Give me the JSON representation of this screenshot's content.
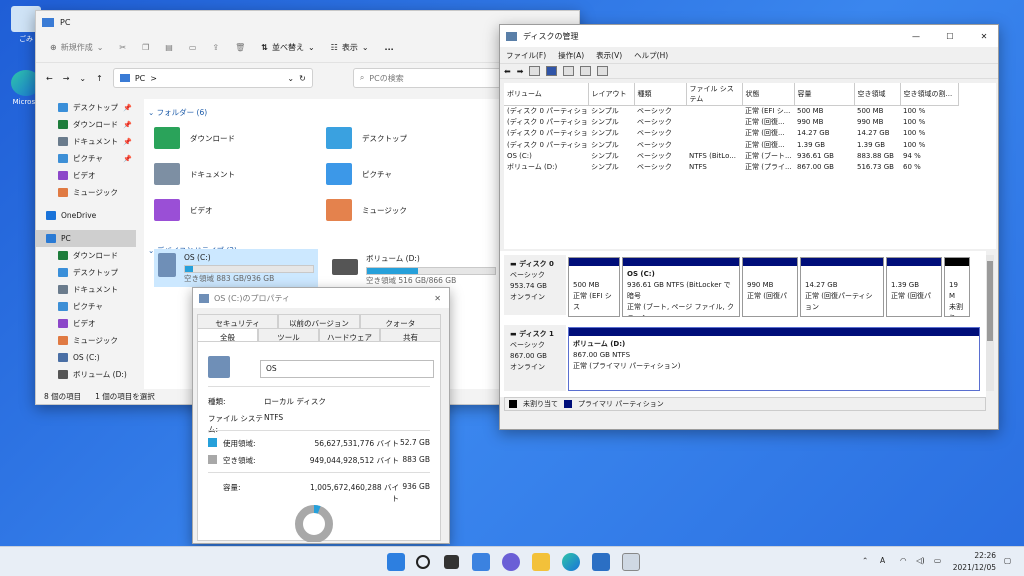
{
  "desktop": {
    "icons": [
      {
        "label": "ごみ"
      },
      {
        "label": "Microso"
      }
    ]
  },
  "explorer": {
    "title": "PC",
    "cmd": {
      "new": "新規作成",
      "sort": "並べ替え",
      "view": "表示",
      "more": "..."
    },
    "address": "PC",
    "address_sep": ">",
    "search_placeholder": "PCの検索",
    "nav": [
      {
        "label": "デスクトップ",
        "pinned": true,
        "color": "#3a8fd9"
      },
      {
        "label": "ダウンロード",
        "pinned": true,
        "color": "#1e7d3c"
      },
      {
        "label": "ドキュメント",
        "pinned": true,
        "color": "#6a7b8c"
      },
      {
        "label": "ピクチャ",
        "pinned": true,
        "color": "#3d8fd6"
      },
      {
        "label": "ビデオ",
        "pinned": false,
        "color": "#8c47c9"
      },
      {
        "label": "ミュージック",
        "pinned": false,
        "color": "#e07a43"
      },
      {
        "label": "OneDrive",
        "pinned": false,
        "color": "#1a73d9"
      },
      {
        "label": "PC",
        "pinned": false,
        "color": "#2a7ad4"
      },
      {
        "label": "ダウンロード",
        "pinned": false,
        "color": "#1e7d3c"
      },
      {
        "label": "デスクトップ",
        "pinned": false,
        "color": "#3a8fd9"
      },
      {
        "label": "ドキュメント",
        "pinned": false,
        "color": "#6a7b8c"
      },
      {
        "label": "ピクチャ",
        "pinned": false,
        "color": "#3d8fd6"
      },
      {
        "label": "ビデオ",
        "pinned": false,
        "color": "#8c47c9"
      },
      {
        "label": "ミュージック",
        "pinned": false,
        "color": "#e07a43"
      },
      {
        "label": "OS (C:)",
        "pinned": false,
        "color": "#4a6fa5"
      },
      {
        "label": "ボリューム (D:)",
        "pinned": false,
        "color": "#555"
      }
    ],
    "folders_header": "フォルダー (6)",
    "folders": [
      {
        "label": "ダウンロード",
        "color": "#2aa35a"
      },
      {
        "label": "デスクトップ",
        "color": "#3aa1e0"
      },
      {
        "label": "ドキュメント",
        "color": "#7d8fa3"
      },
      {
        "label": "ピクチャ",
        "color": "#3c98e8"
      },
      {
        "label": "ビデオ",
        "color": "#9a4fd6"
      },
      {
        "label": "ミュージック",
        "color": "#e4824d"
      }
    ],
    "drives_header": "デバイスとドライブ (2)",
    "drives": [
      {
        "label": "OS (C:)",
        "free": "空き領域 883 GB/936 GB",
        "used_fraction": 0.06
      },
      {
        "label": "ボリューム (D:)",
        "free": "空き領域 516 GB/866 GB",
        "used_fraction": 0.4
      }
    ],
    "status": {
      "count": "8 個の項目",
      "selected": "1 個の項目を選択"
    }
  },
  "props": {
    "title": "OS (C:)のプロパティ",
    "tabs_top": [
      "セキュリティ",
      "以前のバージョン",
      "クォータ"
    ],
    "tabs_bottom": [
      "全般",
      "ツール",
      "ハードウェア",
      "共有"
    ],
    "name": "OS",
    "type_label": "種類:",
    "type_value": "ローカル ディスク",
    "fs_label": "ファイル システム:",
    "fs_value": "NTFS",
    "used_label": "使用領域:",
    "used_bytes": "56,627,531,776 バイト",
    "used_gb": "52.7 GB",
    "free_label": "空き領域:",
    "free_bytes": "949,044,928,512 バイト",
    "free_gb": "883 GB",
    "cap_label": "容量:",
    "cap_bytes": "1,005,672,460,288 バイト",
    "cap_gb": "936 GB",
    "used_fraction": 0.056
  },
  "dm": {
    "title": "ディスクの管理",
    "menu": [
      "ファイル(F)",
      "操作(A)",
      "表示(V)",
      "ヘルプ(H)"
    ],
    "columns": [
      "ボリューム",
      "レイアウト",
      "種類",
      "ファイル システム",
      "状態",
      "容量",
      "空き領域",
      "空き領域の割..."
    ],
    "rows": [
      [
        "(ディスク 0 パーティショ...",
        "シンプル",
        "ベーシック",
        "",
        "正常 (EFI シ...",
        "500 MB",
        "500 MB",
        "100 %"
      ],
      [
        "(ディスク 0 パーティショ...",
        "シンプル",
        "ベーシック",
        "",
        "正常 (回復...",
        "990 MB",
        "990 MB",
        "100 %"
      ],
      [
        "(ディスク 0 パーティショ...",
        "シンプル",
        "ベーシック",
        "",
        "正常 (回復...",
        "14.27 GB",
        "14.27 GB",
        "100 %"
      ],
      [
        "(ディスク 0 パーティショ...",
        "シンプル",
        "ベーシック",
        "",
        "正常 (回復...",
        "1.39 GB",
        "1.39 GB",
        "100 %"
      ],
      [
        "OS (C:)",
        "シンプル",
        "ベーシック",
        "NTFS (BitLo...",
        "正常 (ブート...",
        "936.61 GB",
        "883.88 GB",
        "94 %"
      ],
      [
        "ボリューム (D:)",
        "シンプル",
        "ベーシック",
        "NTFS",
        "正常 (プライ...",
        "867.00 GB",
        "516.73 GB",
        "60 %"
      ]
    ],
    "disk0": {
      "name": "ディスク 0",
      "type": "ベーシック",
      "size": "953.74 GB",
      "state": "オンライン"
    },
    "disk1": {
      "name": "ディスク 1",
      "type": "ベーシック",
      "size": "867.00 GB",
      "state": "オンライン"
    },
    "d0parts": [
      {
        "l1": "",
        "l2": "500 MB",
        "l3": "正常 (EFI シス"
      },
      {
        "l1": "OS  (C:)",
        "l2": "936.61 GB NTFS (BitLocker で暗号",
        "l3": "正常 (ブート, ページ ファイル, クラッシュ"
      },
      {
        "l1": "",
        "l2": "990 MB",
        "l3": "正常 (回復パ"
      },
      {
        "l1": "",
        "l2": "14.27 GB",
        "l3": "正常 (回復パーティション"
      },
      {
        "l1": "",
        "l2": "1.39 GB",
        "l3": "正常 (回復パ"
      },
      {
        "l1": "",
        "l2": "19 M",
        "l3": "未割り"
      }
    ],
    "d1part": {
      "l1": "ボリューム  (D:)",
      "l2": "867.00 GB NTFS",
      "l3": "正常 (プライマリ パーティション)"
    },
    "legend": [
      "未割り当て",
      "プライマリ パーティション"
    ]
  },
  "taskbar": {
    "time": "22:26",
    "date": "2021/12/05",
    "lang": "A"
  }
}
